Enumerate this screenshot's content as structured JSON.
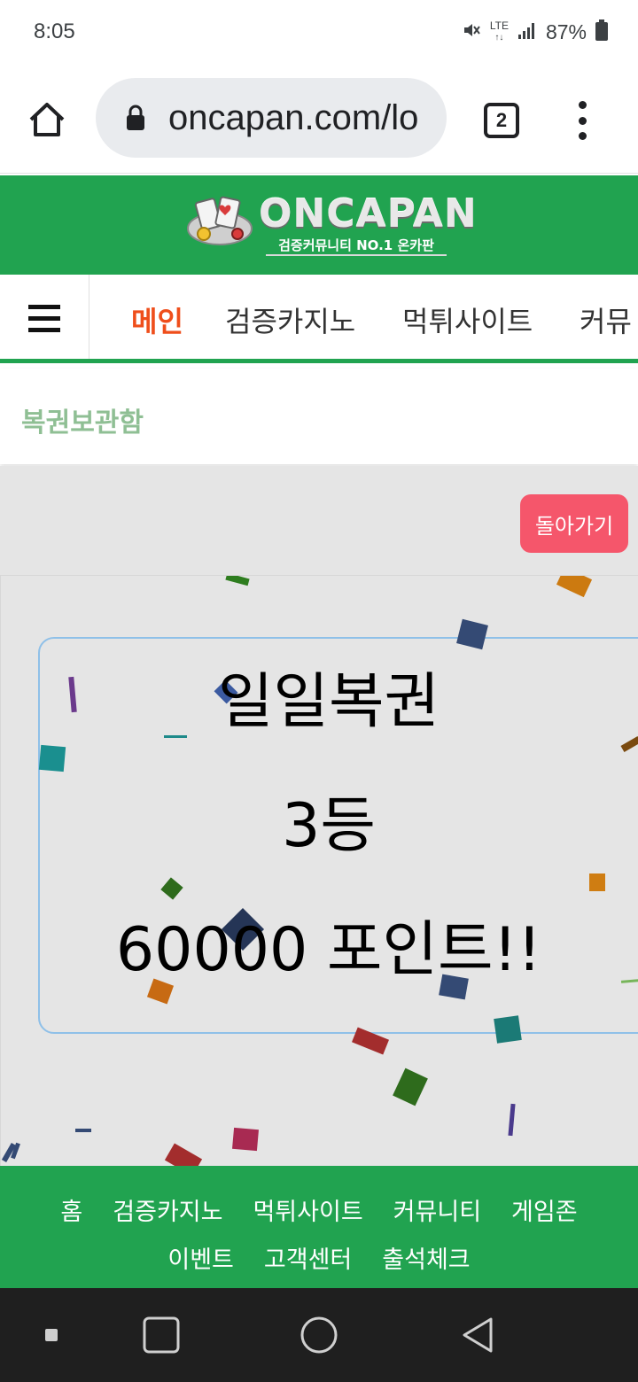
{
  "status_bar": {
    "time": "8:05",
    "network": "LTE",
    "battery": "87%"
  },
  "browser": {
    "url": "oncapan.com/lo",
    "tab_count": "2"
  },
  "site": {
    "logo_name": "ONCAPAN",
    "logo_tagline": "검증커뮤니티 NO.1 온카판",
    "brand_color": "#21a350"
  },
  "nav": {
    "items": [
      {
        "label": "메인",
        "active": true
      },
      {
        "label": "검증카지노",
        "active": false
      },
      {
        "label": "먹튀사이트",
        "active": false
      },
      {
        "label": "커뮤",
        "active": false
      }
    ]
  },
  "page": {
    "title": "복권보관함",
    "back_label": "돌아가기"
  },
  "result": {
    "lottery_name": "일일복권",
    "rank": "3등",
    "prize": "60000 포인트!!"
  },
  "footer": {
    "row1": [
      "홈",
      "검증카지노",
      "먹튀사이트",
      "커뮤니티",
      "게임존"
    ],
    "row2": [
      "이벤트",
      "고객센터",
      "출석체크"
    ]
  }
}
